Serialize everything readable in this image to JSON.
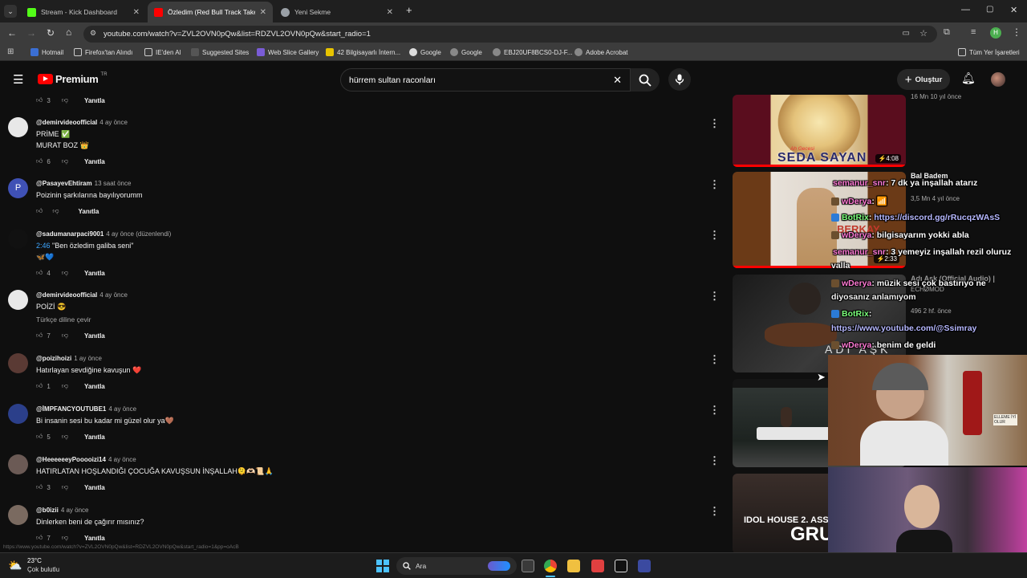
{
  "browser": {
    "tabs": [
      {
        "label": "Stream - Kick Dashboard",
        "favicon_color": "#53fc18"
      },
      {
        "label": "Özledim (Red Bull Track Takeov",
        "favicon_color": "#ff0000"
      },
      {
        "label": "Yeni Sekme",
        "favicon_color": "#9aa0a6"
      }
    ],
    "new_tab": "+",
    "url": "youtube.com/watch?v=ZVL2OVN0pQw&list=RDZVL2OVN0pQw&start_radio=1",
    "profile_initial": "H",
    "bookmarks": [
      "Hotmail",
      "Firefox'tan Alındı",
      "IE'den Al",
      "Suggested Sites",
      "Web Slice Gallery",
      "42 Bilgisayarlı İntern...",
      "Google",
      "Google",
      "EBJ20UF8BCS0-DJ-F...",
      "Adobe Acrobat"
    ],
    "all_bookmarks": "Tüm Yer İşaretleri"
  },
  "youtube": {
    "logo_text": "Premium",
    "logo_sup": "TR",
    "search_value": "hürrem sultan raconları",
    "create_label": "Oluştur",
    "reply_label": "Yanıtla"
  },
  "top_partial": {
    "likes": "3",
    "reply": "Yanıtla"
  },
  "comments": [
    {
      "handle": "@demirvideoofficial",
      "age": "4 ay önce",
      "lines": [
        "PRİME ✅",
        "MURAT BOZ 👑"
      ],
      "likes": "6",
      "avatar_color": "#e8e8e8"
    },
    {
      "handle": "@PasayevEhtiram",
      "age": "13 saat önce",
      "lines": [
        "Poizinin şarkılarına bayılıyorumm"
      ],
      "likes": "",
      "avatar_letter": "P",
      "avatar_color": "#3f51b5"
    },
    {
      "handle": "@sadumanarpaci9001",
      "age": "4 ay önce (düzenlendi)",
      "lines": [
        "2:46 \"Ben özledim galiba seni\"",
        "🦋💙"
      ],
      "timestamp": "2:46",
      "likes": "4",
      "avatar_color": "#111111"
    },
    {
      "handle": "@demirvideoofficial",
      "age": "4 ay önce",
      "lines": [
        "POİZİ 😎"
      ],
      "translate": "Türkçe diline çevir",
      "likes": "7",
      "avatar_color": "#e8e8e8"
    },
    {
      "handle": "@poizihoizi",
      "age": "1 ay önce",
      "lines": [
        "Hatırlayan sevdiğine kavuşun ❤️"
      ],
      "likes": "1",
      "avatar_color": "#5a3a34"
    },
    {
      "handle": "@İMPFANCYOUTUBE1",
      "age": "4 ay önce",
      "lines": [
        "Bi insanin sesi bu kadar mi güzel olur ya🤎"
      ],
      "likes": "5",
      "avatar_color": "#2b3f8a"
    },
    {
      "handle": "@HeeeeeeyPooooizi14",
      "age": "4 ay önce",
      "lines": [
        "HATIRLATAN HOŞLANDIĞI ÇOCUĞA KAVUŞSUN İNŞALLAH🫠🫶🏻📜🙏"
      ],
      "likes": "3",
      "avatar_color": "#6b5a55"
    },
    {
      "handle": "@b0izii",
      "age": "4 ay önce",
      "lines": [
        "Dinlerken beni de çağırır mısınız?"
      ],
      "likes": "7",
      "avatar_color": "#7a6a60"
    }
  ],
  "sidebar": {
    "top_meta": "16 Mn   10 yıl önce",
    "videos": [
      {
        "overlay": "SEDA SAYAN",
        "small_overlay": "Ah Gecesi",
        "duration": "4:08"
      },
      {
        "title": "Bal Badem",
        "meta": "3,5 Mn  4 yıl önce",
        "overlay": "BERKAY",
        "duration": "2:33"
      },
      {
        "title": "Adı Aşk (Official Audio) |",
        "channel": "ECHØMOD",
        "meta": "496  2 hf. önce",
        "overlay": "ADI AŞK"
      },
      {
        "overlay": ""
      },
      {
        "overlay": "IDOL HOUSE 2. ASSES",
        "overlay2": "GRUI"
      }
    ]
  },
  "chat": [
    {
      "user": "semanur_snr",
      "msg": ": 7 dk ya inşallah atarız",
      "user_color": "#ff7bd5"
    },
    {
      "user": "wDerya",
      "msg": ": 📶",
      "user_color": "#ff7bd5"
    },
    {
      "user": "BotRix",
      "msg": ": ",
      "link": "https://discord.gg/rRucqzWAsS",
      "user_color": "#7cff7c"
    },
    {
      "user": "wDerya",
      "msg": ": bilgisayarım yokki abla",
      "user_color": "#ff7bd5"
    },
    {
      "user": "semanur_snr",
      "msg": ": 3 yemeyiz inşallah rezil oluruz",
      "cont": "valla",
      "user_color": "#ff7bd5"
    },
    {
      "user": "wDerya",
      "msg": ": müzik sesi çok bastırıyo ne",
      "cont": "diyosanız anlamıyom",
      "user_color": "#ff7bd5"
    },
    {
      "user": "BotRix",
      "msg": ":",
      "cont_link": "https://www.youtube.com/@Ssimray",
      "user_color": "#7cff7c"
    },
    {
      "user": "wDerya",
      "msg": ": benim de geldi",
      "user_color": "#ff7bd5"
    }
  ],
  "status_url": "https://www.youtube.com/watch?v=ZVL2OVN0pQw&list=RDZVL2OVN0pQw&start_radio=1&pp=oAcB",
  "taskbar": {
    "temp": "23°C",
    "weather": "Çok bulutlu",
    "search": "Ara"
  },
  "webcam": {
    "sign_text": "ELLEME İYİ OLUR"
  }
}
